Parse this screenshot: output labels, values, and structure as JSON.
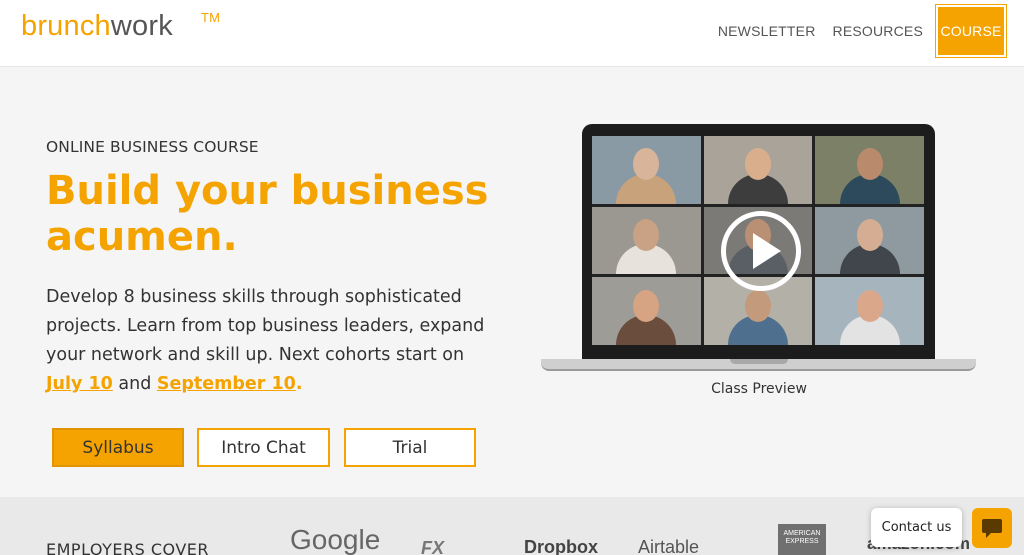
{
  "header": {
    "logo_brunch": "brunch",
    "logo_work": "work",
    "logo_tm": "TM",
    "nav": [
      "NEWSLETTER",
      "RESOURCES",
      "COURSE"
    ]
  },
  "hero": {
    "eyebrow": "ONLINE BUSINESS COURSE",
    "headline": "Build your business acumen.",
    "desc_text": "Develop 8 business skills through sophisticated projects. Learn from top business leaders, expand your network and skill up. Next cohorts start on ",
    "date1": "July 10",
    "desc_and": " and ",
    "date2": "September 10",
    "desc_end": ".",
    "buttons": {
      "syllabus": "Syllabus",
      "intro_chat": "Intro Chat",
      "trial": "Trial"
    }
  },
  "video": {
    "caption": "Class Preview",
    "tiles": [
      {
        "bg": "#8a9aa5",
        "skin": "#d8b49a",
        "shirt": "#c7a27a"
      },
      {
        "bg": "#a9a39a",
        "skin": "#d9ae8c",
        "shirt": "#3d3d3d"
      },
      {
        "bg": "#7b8066",
        "skin": "#b98a6c",
        "shirt": "#2d4a5c"
      },
      {
        "bg": "#9b9791",
        "skin": "#c9a184",
        "shirt": "#e7e2dc"
      },
      {
        "bg": "#7c7a77",
        "skin": "#b99073",
        "shirt": "#5a5f66"
      },
      {
        "bg": "#8e9aa0",
        "skin": "#d4ad92",
        "shirt": "#41464d"
      },
      {
        "bg": "#9d9c96",
        "skin": "#d6a383",
        "shirt": "#6a4d3c"
      },
      {
        "bg": "#b3b0a8",
        "skin": "#c49a7c",
        "shirt": "#4f6f8f"
      },
      {
        "bg": "#a6b5bd",
        "skin": "#dba78b",
        "shirt": "#e3e3e3"
      }
    ]
  },
  "employers": {
    "label": "EMPLOYERS COVER",
    "logos": {
      "google": "Google",
      "fx": "FX",
      "dropbox": "Dropbox",
      "airtable": "Airtable",
      "amex": "AMERICAN EXPRESS",
      "amazon": "amazon.com"
    }
  },
  "contact": {
    "label": "Contact us"
  }
}
